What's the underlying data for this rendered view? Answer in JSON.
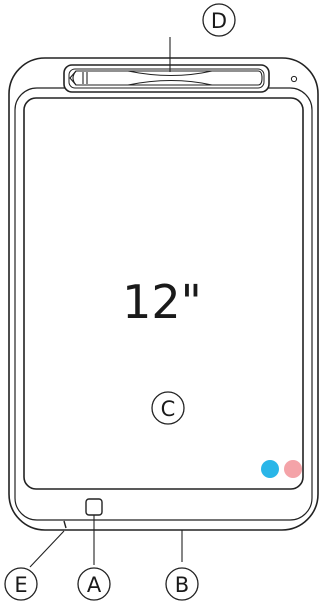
{
  "screen": {
    "size_label": "12\""
  },
  "callouts": {
    "a": "A",
    "b": "B",
    "c": "C",
    "d": "D",
    "e": "E"
  },
  "dots": {
    "left_color": "#2ab6e8",
    "right_color": "#f4a3a8"
  }
}
